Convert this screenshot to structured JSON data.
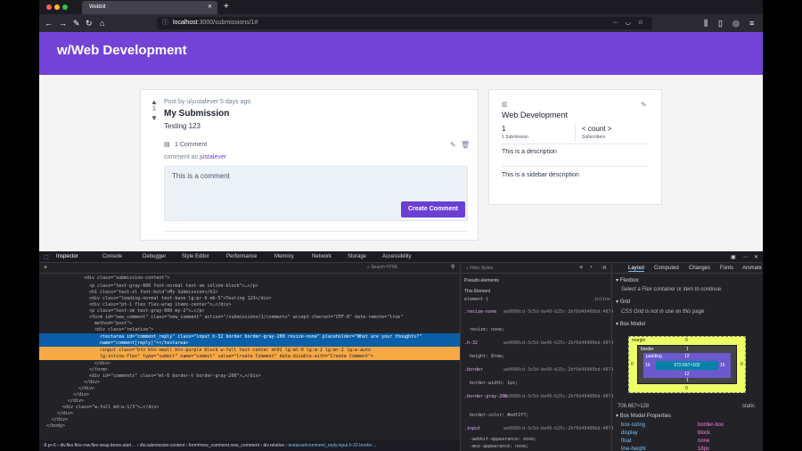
{
  "browser": {
    "tab_title": "Webbit",
    "new_tab": "+",
    "url_host": "localhost",
    "url_path": ":3000/submissions/1#"
  },
  "site": {
    "title": "w/Web Development",
    "post": {
      "votes": "1",
      "meta": "Post by u/justalever 5 days ago",
      "title": "My Submission",
      "body": "Testing 123",
      "comments": "1 Comment",
      "comment_as_prefix": "comment as",
      "comment_as_user": "justalever",
      "comment_placeholder": "This is a comment",
      "submit": "Create Comment"
    },
    "sidebar": {
      "title": "Web Development",
      "submissions_count": "1",
      "submissions_label": "1 Submission",
      "count_placeholder": "< count >",
      "subscribers_label": "Subscribers",
      "description": "This is a description",
      "sidebar_description": "This is a sidebar description"
    }
  },
  "devtools": {
    "tabs": [
      "Inspector",
      "Console",
      "Debugger",
      "Style Editor",
      "Performance",
      "Memory",
      "Network",
      "Storage",
      "Accessibility"
    ],
    "search_placeholder": "Search HTML",
    "filter_placeholder": "Filter Styles",
    "html_lines": [
      "<div class=\"submission-content\">",
      "<p class=\"text-gray-600 font-normal text-sm inline-block\">…</p>",
      "<h1 class=\"text-xl font-bold\">My Submission</h1>",
      "<div class=\"leading-normal text-base lg:pr-6 mb-5\">Testing 123</div>",
      "<div class=\"pt-1 flex flex-wrap items-center\">…</div>",
      "<p class=\"text-sm text-gray-600 my-2\">…</p>",
      "<form id=\"new_comment\" class=\"new_comment\" action=\"/submissions/1/comments\" accept-charset=\"UTF-8\" data-remote=\"true\"",
      "method=\"post\">",
      "<div class=\"relative\">",
      "<textarea id=\"comment_reply\" class=\"input h-32 border border-gray-200 resize-none\" placeholder=\"What are your thoughts?\"",
      "name=\"comment[reply]\"></textarea>",
      "<input class=\"btn btn-small btn-purple block w-full text-center mt02 lg:mt-0 lg:m-2 lg:mr-2 lg:w-auto",
      "lg:inline-flex\" type=\"submit\" name=\"commit\" value=\"Create Comment\" data-disable-with=\"Create Comment\">",
      "</div>",
      "</form>",
      "<div id=\"comments\" class=\"mt-6 border-t border-gray-200\">…</div>",
      "</div>",
      "</div>",
      "</div>",
      "</div>",
      "<div class=\"w-full md:w-1/3\">…</div>",
      "</div>",
      "</div>",
      "</body>"
    ],
    "breadcrumbs": [
      "-6.pr-6",
      "div.flex.flex-row.flex-wrap.items-start…",
      "div.submission-content",
      "form#new_comment.new_comment",
      "div.relative",
      "textarea#comment_reply.input.h-32.border…"
    ],
    "rules": {
      "pseudo": "Pseudo-elements",
      "this_element": "This Element",
      "element": "element {",
      "inline": "inline",
      "r1_sel": ".resize-none",
      "r1_prop": "resize: none;",
      "r2_sel": ".h-32",
      "r2_prop": "height: 8rem;",
      "r3_sel": ".border",
      "r3_prop": "border-width: 1px;",
      "r4_sel": ".border-gray-200",
      "r4_prop": "border-color: #edf2f7;",
      "r5_sel": ".input",
      "r5_prop": "-webkit-appearance: none;",
      "r5_prop2": "-moz-appearance: none;",
      "src": "ae0080cd-3c5d-be49-b25c-2bf0d49400bd:4874"
    },
    "layout_tabs": [
      "Layout",
      "Computed",
      "Changes",
      "Fonts",
      "Animations"
    ],
    "flexbox": "Flexbox",
    "flexbox_msg": "Select a Flex container or item to continue.",
    "grid": "Grid",
    "grid_msg": "CSS Grid is not in use on this page",
    "box_model": "Box Model",
    "box": {
      "margin": "margin",
      "border": "border",
      "padding": "padding",
      "content": "672.667×102",
      "pad": "12",
      "bor": "1",
      "mar": "0",
      "lpad": "16",
      "rpad": "16"
    },
    "dims": "706.667×128",
    "position": "static",
    "props_title": "Box Model Properties",
    "props": [
      [
        "box-sizing",
        "border-box"
      ],
      [
        "display",
        "block"
      ],
      [
        "float",
        "none"
      ],
      [
        "line-height",
        "18px"
      ]
    ]
  },
  "colors": {
    "brand": "#7343d7",
    "button": "#6b3fd6",
    "selected_line": "#0a5fa8",
    "highlight_line": "#f6a945"
  }
}
